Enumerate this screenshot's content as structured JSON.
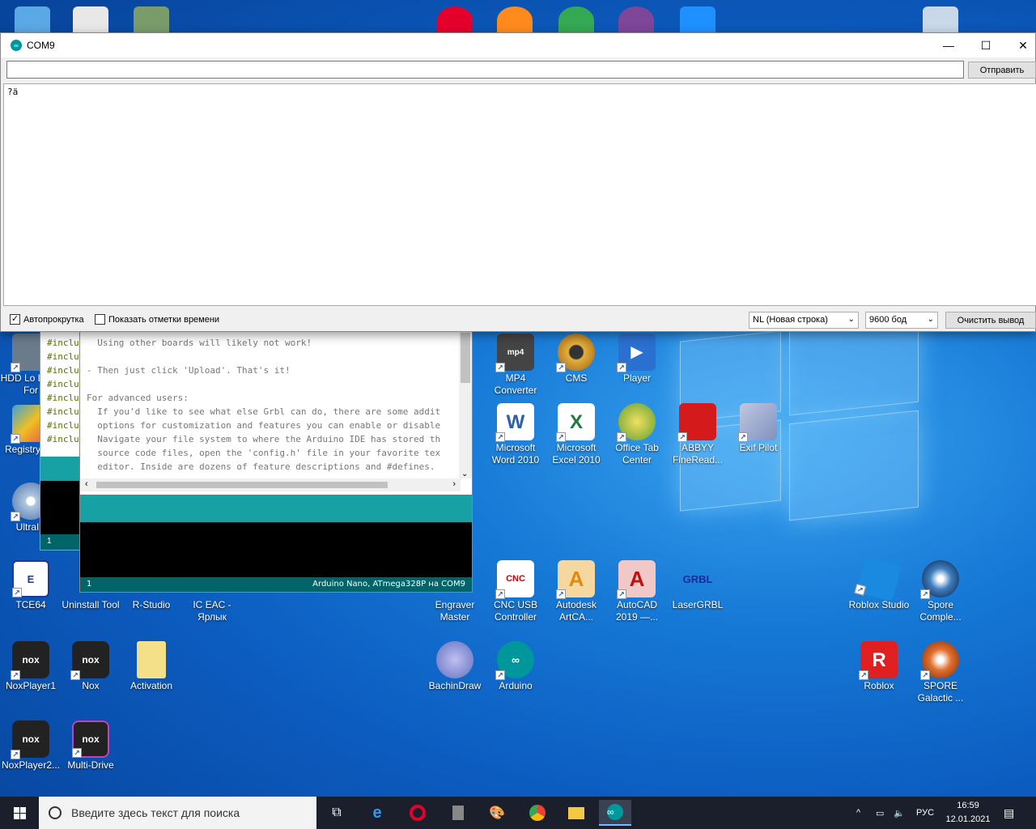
{
  "serial_monitor": {
    "title": "COM9",
    "send_input_value": "",
    "send_button": "Отправить",
    "output_text": "?ä",
    "autoscroll_label": "Автопрокрутка",
    "autoscroll_checked": "✓",
    "timestamps_label": "Показать отметки времени",
    "line_ending": "NL (Новая строка)",
    "baud_rate": "9600 бод",
    "clear_button": "Очистить вывод",
    "minimize": "—",
    "maximize": "☐",
    "close": "✕"
  },
  "ide_back": {
    "code_lines": [
      "#inclu",
      "#inclu",
      "#inclu",
      "#inclu",
      "#inclu",
      "#inclu",
      "#inclu",
      "#inclu"
    ],
    "status_line": "1"
  },
  "ide_front": {
    "code": "  Using other boards will likely not work!\n\n- Then just click 'Upload'. That's it!\n\nFor advanced users:\n  If you'd like to see what else Grbl can do, there are some addit\n  options for customization and features you can enable or disable\n  Navigate your file system to where the Arduino IDE has stored th\n  source code files, open the 'config.h' file in your favorite tex\n  editor. Inside are dozens of feature descriptions and #defines.",
    "status_line": "1",
    "board": "Arduino Nano, ATmega328P на COM9"
  },
  "desktop_icons": {
    "hdd": "HDD Lo Level For",
    "registry": "Registry Aid",
    "ultra": "UltraIS",
    "mp4": "MP4 Converter",
    "cms": "CMS",
    "player": "Player",
    "word": "Microsoft Word 2010",
    "excel": "Microsoft Excel 2010",
    "officetab": "Office Tab Center",
    "abbyy": "ABBYY FineRead...",
    "exif": "Exif Pilot",
    "tce": "TCE64",
    "uninstall": "Uninstall Tool",
    "rstudio": "R-Studio",
    "iceac": "IC EAC - Ярлык",
    "engraver": "Engraver Master",
    "cnc": "CNC USB Controller",
    "artcam": "Autodesk ArtCA...",
    "autocad": "AutoCAD 2019 —...",
    "lasergrbl": "LaserGRBL",
    "roblox_studio": "Roblox Studio",
    "spore_complete": "Spore Comple...",
    "noxplayer1": "NoxPlayer1",
    "nox": "Nox",
    "activation": "Activation",
    "bachin": "BachinDraw",
    "arduino": "Arduino",
    "roblox": "Roblox",
    "spore_galactic": "SPORE Galactic ...",
    "noxplayer2": "NoxPlayer2...",
    "multidrive": "Multi-Drive"
  },
  "taskbar": {
    "search_placeholder": "Введите здесь текст для поиска",
    "language": "РУС",
    "time": "16:59",
    "date": "12.01.2021"
  },
  "colors": {
    "arduino_teal": "#17a1a5",
    "arduino_status": "#006468",
    "taskbar": "#1a1f2b"
  }
}
